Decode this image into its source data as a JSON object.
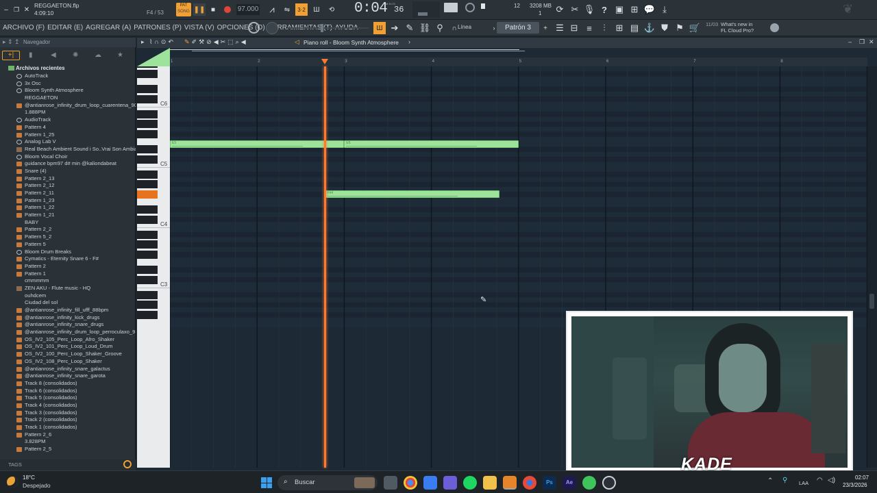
{
  "window": {
    "file_name": "REGGAETON.flp",
    "song_time": "4:09:10",
    "position_info": "F4 / 53"
  },
  "transport": {
    "pat_label": "PAT",
    "song_label": "SONG",
    "tempo": "97.000",
    "time_display": "0:04",
    "time_sub": "36",
    "time_unit": "M:S:CS",
    "cpu_count": "12",
    "memory": "3208 MB",
    "mem_sub": "1"
  },
  "menu": {
    "items": [
      "ARCHIVO (F)",
      "EDITAR (E)",
      "AGREGAR (A)",
      "PATRONES (P)",
      "VISTA (V)",
      "OPCIONES (O)",
      "HERRAMIENTAS (T)",
      "AYUDA"
    ],
    "snap_label": "Línea",
    "pattern_label": "Patrón 3",
    "news_date": "11/03",
    "news_text": "What's new in FL Cloud Pro?"
  },
  "browser": {
    "title": "Navegador",
    "section": "Archivos recientes",
    "tags_label": "TAGS",
    "items": [
      {
        "label": "AutoTrack",
        "icon": "gear"
      },
      {
        "label": "3x Osc",
        "icon": "gear"
      },
      {
        "label": "Bloom Synth Atmosphere",
        "icon": "gear"
      },
      {
        "label": "REGGAETON",
        "icon": "none"
      },
      {
        "label": "@antianrose_infinity_drum_loop_cuarentena_90bpm",
        "icon": "folder"
      },
      {
        "label": "1.888PM",
        "icon": "none"
      },
      {
        "label": "AudioTrack",
        "icon": "gear"
      },
      {
        "label": "Pattern 4",
        "icon": "folder"
      },
      {
        "label": "Pattern 1_25",
        "icon": "folder"
      },
      {
        "label": "Analog Lab V",
        "icon": "gear"
      },
      {
        "label": "Real Beach Ambient Sound i So..Vrai Son Ambiant de Plage",
        "icon": "audio"
      },
      {
        "label": "Bloom Vocal Choir",
        "icon": "gear"
      },
      {
        "label": "guidance bpm97 d# min @kaliondabeat",
        "icon": "folder"
      },
      {
        "label": "Snare (4)",
        "icon": "folder"
      },
      {
        "label": "Pattern 2_13",
        "icon": "folder"
      },
      {
        "label": "Pattern 2_12",
        "icon": "folder"
      },
      {
        "label": "Pattern 2_11",
        "icon": "folder"
      },
      {
        "label": "Pattern 1_23",
        "icon": "folder"
      },
      {
        "label": "Pattern 1_22",
        "icon": "folder"
      },
      {
        "label": "Pattern 1_21",
        "icon": "folder"
      },
      {
        "label": "BABY",
        "icon": "none"
      },
      {
        "label": "Pattern 2_2",
        "icon": "folder"
      },
      {
        "label": "Pattern 5_2",
        "icon": "folder"
      },
      {
        "label": "Pattern 5",
        "icon": "folder"
      },
      {
        "label": "Bloom Drum Breaks",
        "icon": "gear"
      },
      {
        "label": "Cymatics - Eternity Snare 6 - F#",
        "icon": "folder"
      },
      {
        "label": "Pattern 2",
        "icon": "folder"
      },
      {
        "label": "Pattern 1",
        "icon": "folder"
      },
      {
        "label": "cmmmmm",
        "icon": "none"
      },
      {
        "label": "ZEN AKU - Flute music - HQ",
        "icon": "audio"
      },
      {
        "label": "ouhdcem",
        "icon": "none"
      },
      {
        "label": "Ciudad del sol",
        "icon": "none"
      },
      {
        "label": "@antianrose_infinity_fill_ufff_88bpm",
        "icon": "folder"
      },
      {
        "label": "@antianrose_infinity_kick_drugs",
        "icon": "folder"
      },
      {
        "label": "@antianrose_infinity_snare_drugs",
        "icon": "folder"
      },
      {
        "label": "@antianrose_infinity_drum_loop_perroculaxo_91bpm",
        "icon": "folder"
      },
      {
        "label": "OS_IV2_105_Perc_Loop_Afro_Shaker",
        "icon": "folder"
      },
      {
        "label": "OS_IV2_101_Perc_Loop_Loud_Drum",
        "icon": "folder"
      },
      {
        "label": "OS_IV2_100_Perc_Loop_Shaker_Groove",
        "icon": "folder"
      },
      {
        "label": "OS_IV2_108_Perc_Loop_Shaker",
        "icon": "folder"
      },
      {
        "label": "@antianrose_infinity_snare_galactus",
        "icon": "folder"
      },
      {
        "label": "@antianrose_infinity_snare_garota",
        "icon": "folder"
      },
      {
        "label": "Track 8 (consolidados)",
        "icon": "folder"
      },
      {
        "label": "Track 6 (consolidados)",
        "icon": "folder"
      },
      {
        "label": "Track 5 (consolidados)",
        "icon": "folder"
      },
      {
        "label": "Track 4 (consolidados)",
        "icon": "folder"
      },
      {
        "label": "Track 3 (consolidados)",
        "icon": "folder"
      },
      {
        "label": "Track 2 (consolidados)",
        "icon": "folder"
      },
      {
        "label": "Track 1 (consolidados)",
        "icon": "folder"
      },
      {
        "label": "Pattern 2_6",
        "icon": "folder"
      },
      {
        "label": "3.828PM",
        "icon": "none"
      },
      {
        "label": "Pattern 2_5",
        "icon": "folder"
      }
    ]
  },
  "piano_roll": {
    "title": "Piano roll - Bloom Synth Atmosphere",
    "bars": [
      "1",
      "2",
      "3",
      "4",
      "5",
      "6",
      "7",
      "8"
    ],
    "octaves": [
      "C6",
      "C5",
      "C4",
      "C3"
    ],
    "notes": [
      {
        "label": "E5",
        "start_bar": 1.0,
        "length_bars": 2.0
      },
      {
        "label": "E5",
        "start_bar": 3.0,
        "length_bars": 2.0
      },
      {
        "label": "F#4",
        "start_bar": 2.78,
        "length_bars": 2.0
      }
    ],
    "playhead_bar": 2.78
  },
  "webcam": {
    "overlay_name": "KADE"
  },
  "taskbar": {
    "weather_temp": "18°C",
    "weather_text": "Despejado",
    "search_placeholder": "Buscar",
    "lang": "LAA",
    "time": "02:07",
    "date": "23/3/2026"
  },
  "colors": {
    "note_fill": "#9ee39c",
    "playhead": "#ff7a2e",
    "accent_orange": "#f2a033",
    "record_red": "#e0453a"
  }
}
